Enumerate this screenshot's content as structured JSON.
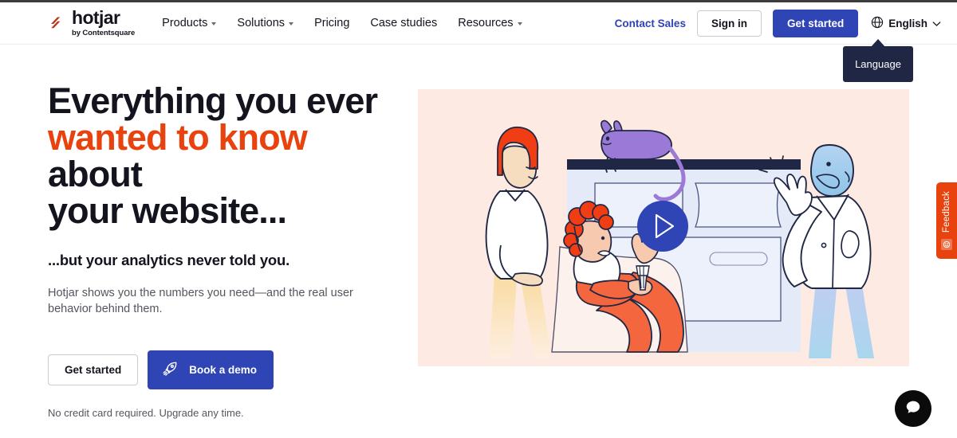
{
  "brand": {
    "logo_word": "hotjar",
    "logo_tagline": "by Contentsquare",
    "logo_mark_icon": "hotjar-slash-mark-icon",
    "accent_orange": "#e8430f",
    "accent_blue": "#2f44b5",
    "ink": "#14141e"
  },
  "header": {
    "nav": [
      {
        "label": "Products",
        "has_caret": true,
        "icon": "chevron-down-icon"
      },
      {
        "label": "Solutions",
        "has_caret": true,
        "icon": "chevron-down-icon"
      },
      {
        "label": "Pricing",
        "has_caret": false,
        "icon": ""
      },
      {
        "label": "Case studies",
        "has_caret": false,
        "icon": ""
      },
      {
        "label": "Resources",
        "has_caret": true,
        "icon": "chevron-down-icon"
      }
    ],
    "contact_sales": "Contact Sales",
    "sign_in": "Sign in",
    "get_started": "Get started",
    "language": {
      "value": "English",
      "globe_icon": "globe-icon",
      "caret_icon": "chevron-down-icon"
    }
  },
  "tooltip": {
    "text": "Language"
  },
  "hero": {
    "headline_line1": "Everything you ever",
    "headline_accent": "wanted to know",
    "headline_line2_rest": " about",
    "headline_line3": "your website...",
    "subhead": "...but your analytics never told you.",
    "body": "Hotjar shows you the numbers you need—and the real user behavior behind them.",
    "cta_secondary": "Get started",
    "cta_primary": "Book a demo",
    "cta_primary_icon": "rocket-icon",
    "fineprint": "No credit card required. Upgrade any time.",
    "illustration": {
      "background": "#fdeae2",
      "play_button_icon": "play-icon",
      "elements": [
        "purple-cat",
        "browser-window",
        "woman-red-bob-haircut",
        "man-orange-curly-hair-seated",
        "blue-skinned-man-lab-coat",
        "popcorn-cup",
        "play-button"
      ]
    }
  },
  "feedback_widget": {
    "label": "Feedback",
    "icon": "smiley-feedback-icon",
    "color": "#e8430f"
  },
  "chat_widget": {
    "icon": "chat-bubble-icon",
    "color": "#0b0b0b"
  }
}
